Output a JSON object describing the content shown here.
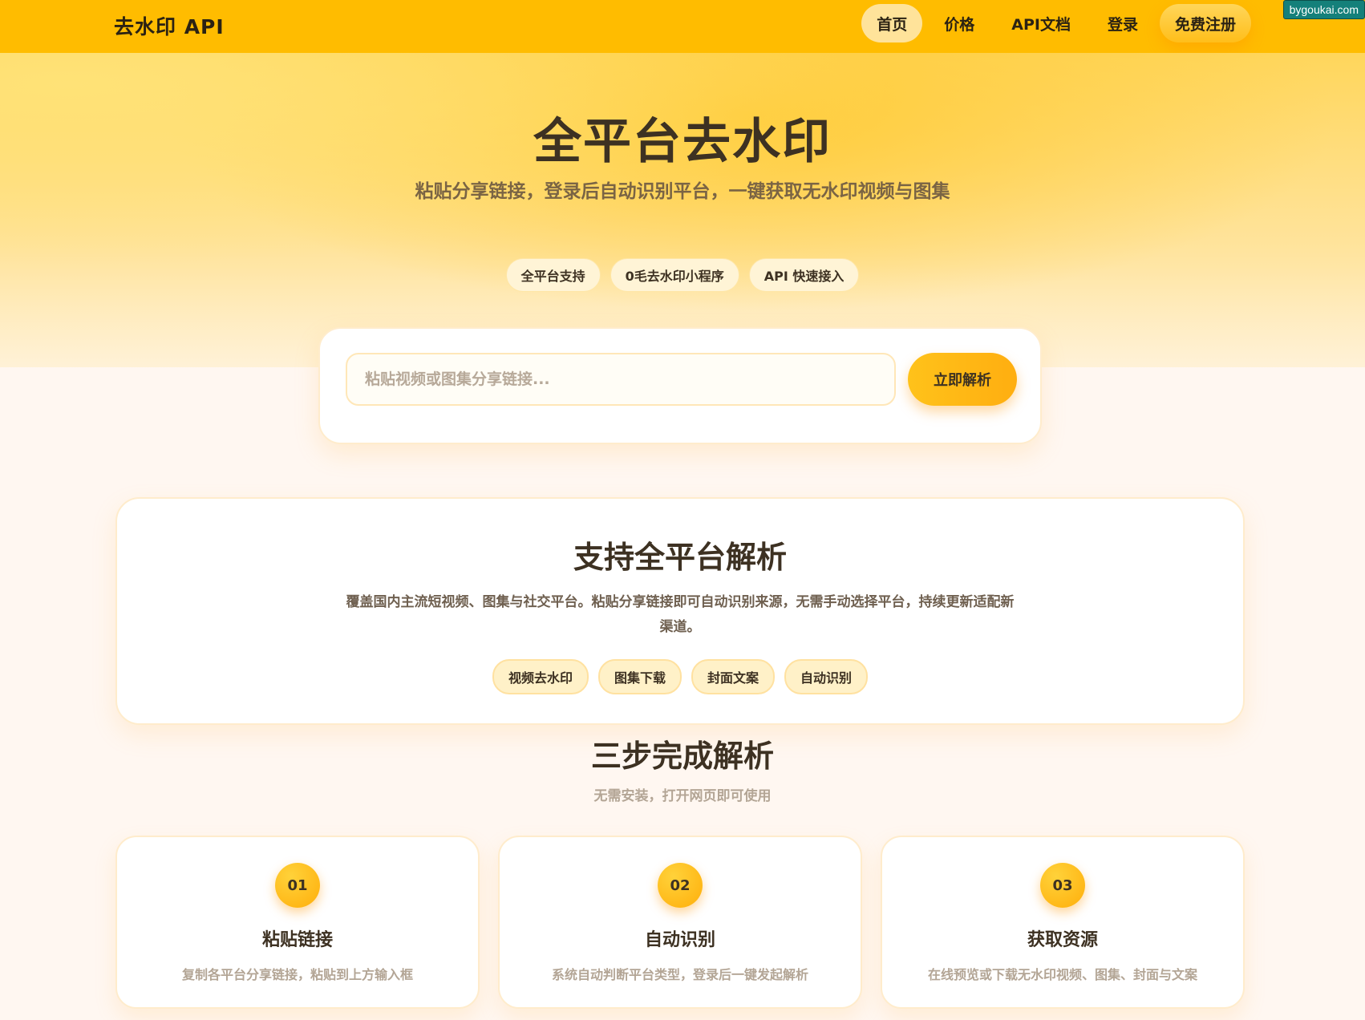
{
  "nav": {
    "brand": "去水印 API",
    "links": [
      {
        "label": "首页",
        "active": true
      },
      {
        "label": "价格",
        "active": false
      },
      {
        "label": "API文档",
        "active": false
      },
      {
        "label": "登录",
        "active": false
      },
      {
        "label": "免费注册",
        "active": false
      }
    ],
    "corner_badge": "bygoukai.com"
  },
  "hero": {
    "title": "全平台去水印",
    "subtitle": "粘贴分享链接，登录后自动识别平台，一键获取无水印视频与图集",
    "chips": [
      "全平台支持",
      "0毛去水印小程序",
      "API 快速接入"
    ]
  },
  "search": {
    "placeholder": "粘贴视频或图集分享链接...",
    "button_label": "立即解析"
  },
  "platforms": {
    "title": "支持全平台解析",
    "description": "覆盖国内主流短视频、图集与社交平台。粘贴分享链接即可自动识别来源，无需手动选择平台，持续更新适配新渠道。",
    "chips": [
      "视频去水印",
      "图集下载",
      "封面文案",
      "自动识别"
    ]
  },
  "steps": {
    "title": "三步完成解析",
    "subtitle": "无需安装，打开网页即可使用",
    "items": [
      {
        "num": "01",
        "title": "粘贴链接",
        "desc": "复制各平台分享链接，粘贴到上方输入框"
      },
      {
        "num": "02",
        "title": "自动识别",
        "desc": "系统自动判断平台类型，登录后一键发起解析"
      },
      {
        "num": "03",
        "title": "获取资源",
        "desc": "在线预览或下载无水印视频、图集、封面与文案"
      }
    ]
  },
  "colors": {
    "nav_bg": "#ffbc00",
    "accent": "#ffae10",
    "text_dark": "#3d3122",
    "page_bg": "#fff7f1"
  }
}
